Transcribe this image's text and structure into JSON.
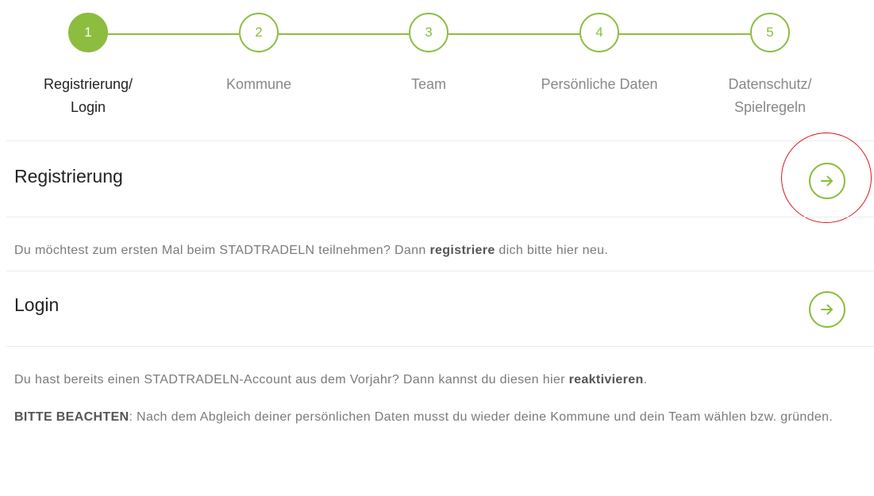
{
  "accent_color": "#8cbd3f",
  "highlight_color": "#e0141b",
  "stepper": {
    "active_step": 1,
    "steps": [
      {
        "number": "1",
        "label_line1": "Registrierung/",
        "label_line2": "Login"
      },
      {
        "number": "2",
        "label_line1": "Kommune",
        "label_line2": ""
      },
      {
        "number": "3",
        "label_line1": "Team",
        "label_line2": ""
      },
      {
        "number": "4",
        "label_line1": "Persönliche Daten",
        "label_line2": ""
      },
      {
        "number": "5",
        "label_line1": "Datenschutz/",
        "label_line2": "Spielregeln"
      }
    ]
  },
  "registration": {
    "title": "Registrierung",
    "button_icon": "arrow-right-circle-icon",
    "desc_before": "Du möchtest zum ersten Mal beim STADTRADELN teilnehmen? Dann ",
    "desc_bold": "registriere",
    "desc_after": " dich bitte hier neu."
  },
  "login": {
    "title": "Login",
    "button_icon": "arrow-right-circle-icon",
    "desc_before": "Du hast bereits einen STADTRADELN-Account aus dem Vorjahr? Dann kannst du diesen hier ",
    "desc_bold": "reaktivieren",
    "desc_after": ".",
    "note_bold": "BITTE BEACHTEN",
    "note_text": ": Nach dem Abgleich deiner persönlichen Daten musst du wieder deine Kommune und dein Team wählen bzw. gründen."
  }
}
